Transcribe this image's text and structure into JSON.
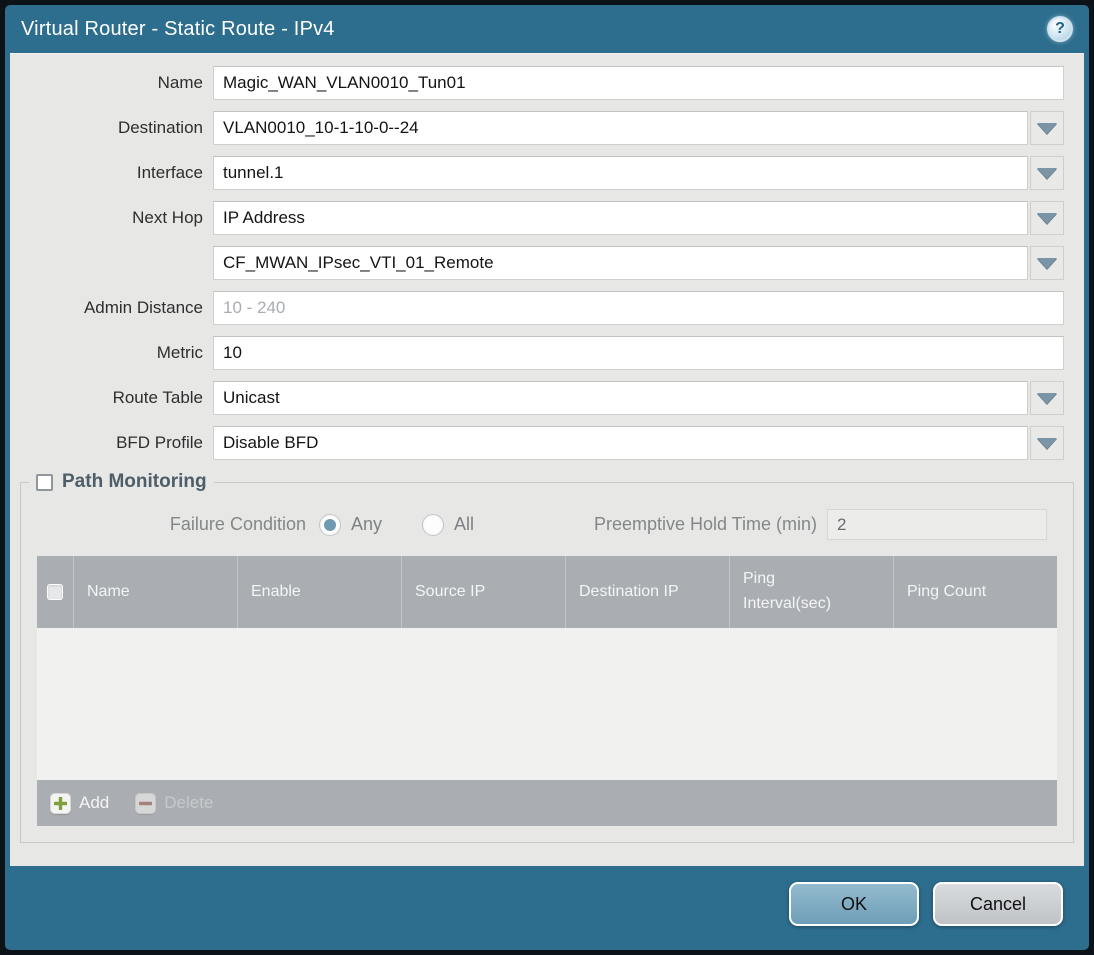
{
  "window": {
    "title": "Virtual Router - Static Route - IPv4"
  },
  "icons": {
    "help": "?"
  },
  "form": {
    "name": {
      "label": "Name",
      "value": "Magic_WAN_VLAN0010_Tun01"
    },
    "destination": {
      "label": "Destination",
      "value": "VLAN0010_10-1-10-0--24"
    },
    "interface": {
      "label": "Interface",
      "value": "tunnel.1"
    },
    "next_hop": {
      "label": "Next Hop",
      "value": "IP Address"
    },
    "next_hop_address": {
      "value": "CF_MWAN_IPsec_VTI_01_Remote"
    },
    "admin_distance": {
      "label": "Admin Distance",
      "placeholder": "10 - 240"
    },
    "metric": {
      "label": "Metric",
      "value": "10"
    },
    "route_table": {
      "label": "Route Table",
      "value": "Unicast"
    },
    "bfd_profile": {
      "label": "BFD Profile",
      "value": "Disable BFD"
    }
  },
  "path_monitoring": {
    "title": "Path Monitoring",
    "checked": false,
    "failure_condition": {
      "label": "Failure Condition",
      "options": [
        "Any",
        "All"
      ],
      "selected": "Any"
    },
    "preemptive_hold": {
      "label": "Preemptive Hold Time (min)",
      "value": "2"
    },
    "table": {
      "columns": [
        "Name",
        "Enable",
        "Source IP",
        "Destination IP",
        "Ping Interval(sec)",
        "Ping Count"
      ],
      "rows": [],
      "select_all_checked": false,
      "add_label": "Add",
      "delete_label": "Delete",
      "delete_enabled": false
    }
  },
  "footer": {
    "ok_label": "OK",
    "cancel_label": "Cancel"
  },
  "colors": {
    "titlebar": "#2d6e8e",
    "content_bg": "#e7e7e6",
    "table_header": "#aaaeb2",
    "ok_button": "#7ba6bd",
    "add_icon_green": "#7fa03c",
    "delete_icon_red": "#a4665c",
    "arrow_blue": "#7c95a6"
  }
}
